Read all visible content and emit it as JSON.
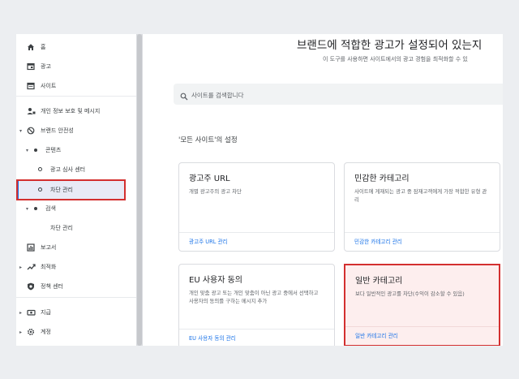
{
  "sidebar": {
    "home": {
      "label": "홈",
      "icon": "home-icon"
    },
    "ads": {
      "label": "광고",
      "icon": "ad-icon"
    },
    "sites": {
      "label": "사이트",
      "icon": "browser-icon"
    },
    "privacy": {
      "label": "개인 정보 보호 및 메시지",
      "icon": "privacy-icon"
    },
    "brand_safety": {
      "label": "브랜드 안전성",
      "icon": "block-icon"
    },
    "content": {
      "label": "콘텐츠"
    },
    "ad_review": {
      "label": "광고 심사 센터"
    },
    "blocking_controls": {
      "label": "차단 관리"
    },
    "search": {
      "label": "검색"
    },
    "search_blocking": {
      "label": "차단 관리"
    },
    "reports": {
      "label": "보고서",
      "icon": "chart-icon"
    },
    "optimization": {
      "label": "최적화",
      "icon": "trending-up-icon"
    },
    "policy_center": {
      "label": "정책 센터",
      "icon": "shield-icon"
    },
    "payments": {
      "label": "지급",
      "icon": "payments-icon"
    },
    "account": {
      "label": "계정",
      "icon": "gear-icon"
    }
  },
  "header": {
    "title": "브랜드에 적합한 광고가 설정되어 있는지",
    "description": "이 도구를 사용하면 사이트에서의 광고 경험을 최적화할 수 있"
  },
  "search": {
    "placeholder": "사이트를 검색합니다"
  },
  "section_title": "'모든 사이트'의 설정",
  "cards": [
    {
      "title": "광고주 URL",
      "description": "개별 광고주의 광고 차단",
      "link": "광고주 URL 관리"
    },
    {
      "title": "민감한 카테고리",
      "description": "사이트에 게재되는 광고 중 잠재고객에게 가장 적합한 유형 관리",
      "link": "민감한 카테고리 관리"
    },
    {
      "title": "EU 사용자 동의",
      "description": "개인 맞춤 광고 또는 개인 맞춤이 아닌 광고 중에서 선택하고 사용자의 동의를 구하는 메시지 추가",
      "link": "EU 사용자 동의 관리"
    },
    {
      "title": "일반 카테고리",
      "description": "보다 일반적인 광고를 차단(수익이 감소할 수 있음)",
      "link": "일반 카테고리 관리"
    }
  ],
  "colors": {
    "accent": "#1a73e8",
    "highlight": "#d32f2f"
  }
}
